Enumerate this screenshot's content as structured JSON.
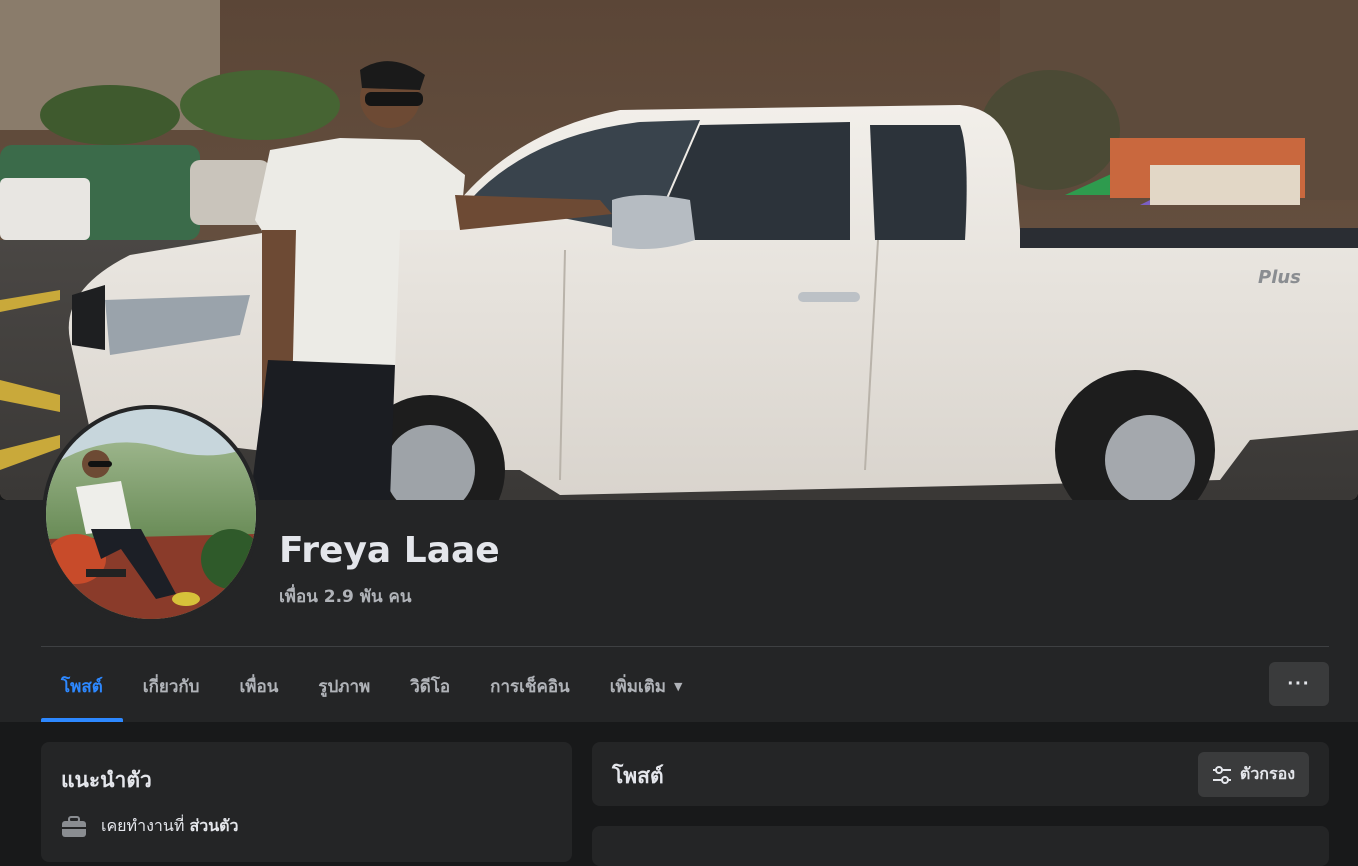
{
  "profile": {
    "name": "Freya Laae",
    "friends": "เพื่อน 2.9 พัน คน"
  },
  "tabs": [
    {
      "label": "โพสต์",
      "active": true
    },
    {
      "label": "เกี่ยวกับ",
      "active": false
    },
    {
      "label": "เพื่อน",
      "active": false
    },
    {
      "label": "รูปภาพ",
      "active": false
    },
    {
      "label": "วิดีโอ",
      "active": false
    },
    {
      "label": "การเช็คอิน",
      "active": false
    },
    {
      "label": "เพิ่มเติม",
      "active": false
    }
  ],
  "more_button": "···",
  "intro": {
    "title": "แนะนำตัว",
    "work_prefix": "เคยทำงานที่",
    "work_place": "ส่วนตัว",
    "icon": "briefcase-icon"
  },
  "posts": {
    "title": "โพสต์",
    "filter_label": "ตัวกรอง",
    "filter_icon": "sliders-icon"
  },
  "colors": {
    "accent": "#2d88ff",
    "background": "#18191a",
    "card": "#242526",
    "button": "#3a3b3c"
  }
}
